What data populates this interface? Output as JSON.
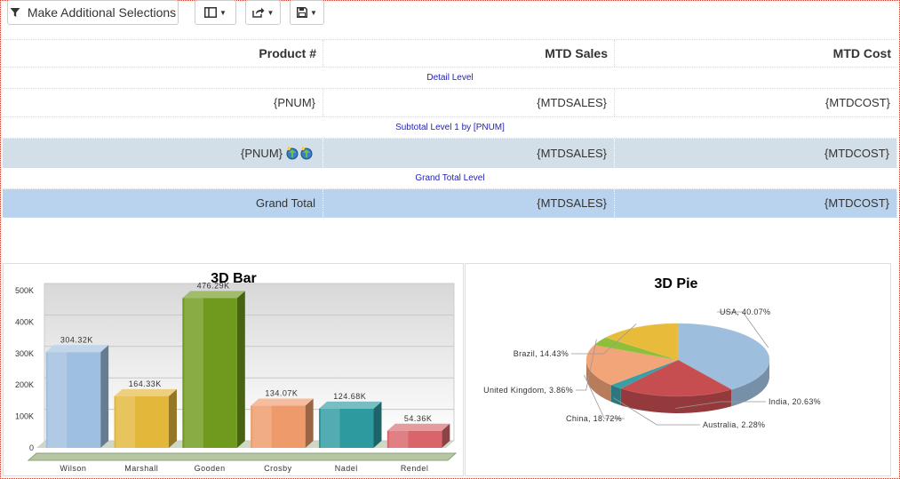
{
  "toolbar": {
    "selections_label": "Make Additional Selections",
    "columns_icon": "columns-icon",
    "export_icon": "export-icon",
    "save_icon": "save-icon"
  },
  "table": {
    "headers": [
      "Product #",
      "MTD Sales",
      "MTD Cost"
    ],
    "detail_level_label": "Detail Level",
    "detail_row": [
      "{PNUM}",
      "{MTDSALES}",
      "{MTDCOST}"
    ],
    "subtotal_level_label": "Subtotal Level 1 by [PNUM]",
    "subtotal_row": [
      "{PNUM}",
      "{MTDSALES}",
      "{MTDCOST}"
    ],
    "grand_total_level_label": "Grand Total Level",
    "grand_total_row": [
      "Grand Total",
      "{MTDSALES}",
      "{MTDCOST}"
    ]
  },
  "colors": {
    "subtotal_bg": "#d2dfe8",
    "grand_total_bg": "#b9d3ef",
    "level_text": "#1f1fb5"
  },
  "chart_data": [
    {
      "type": "bar",
      "title": "3D Bar",
      "categories": [
        "Wilson",
        "Marshall",
        "Gooden",
        "Crosby",
        "Nadel",
        "Rendel"
      ],
      "values": [
        304320,
        164330,
        476290,
        134070,
        124680,
        54360
      ],
      "data_labels": [
        "304.32K",
        "164.33K",
        "476.29K",
        "134.07K",
        "124.68K",
        "54.36K"
      ],
      "ylim": [
        0,
        500000
      ],
      "yticks": [
        "0",
        "100K",
        "200K",
        "300K",
        "400K",
        "500K"
      ],
      "colors": [
        "#9fbfe0",
        "#e2b73a",
        "#6f9a1d",
        "#ef9a6a",
        "#2d9aa0",
        "#d9656a"
      ],
      "grid": true
    },
    {
      "type": "pie",
      "title": "3D Pie",
      "slices": [
        {
          "label": "USA, 40.07%",
          "value": 40.07,
          "color": "#9ebede"
        },
        {
          "label": "India, 20.63%",
          "value": 20.63,
          "color": "#c64d50"
        },
        {
          "label": "Australia, 2.28%",
          "value": 2.28,
          "color": "#3a9ea6"
        },
        {
          "label": "China, 18.72%",
          "value": 18.72,
          "color": "#f3a57a"
        },
        {
          "label": "United Kingdom, 3.86%",
          "value": 3.86,
          "color": "#8fbf3a"
        },
        {
          "label": "Brazil, 14.43%",
          "value": 14.43,
          "color": "#e8bc3a"
        }
      ]
    }
  ]
}
